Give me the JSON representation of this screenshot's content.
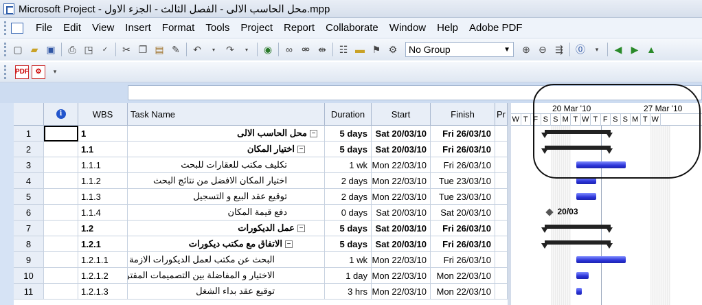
{
  "window": {
    "title": "Microsoft Project - محل الحاسب الالى - الفصل الثالث - الجزء الاول.mpp"
  },
  "menu": [
    {
      "label": "File"
    },
    {
      "label": "Edit"
    },
    {
      "label": "View"
    },
    {
      "label": "Insert"
    },
    {
      "label": "Format"
    },
    {
      "label": "Tools"
    },
    {
      "label": "Project"
    },
    {
      "label": "Report"
    },
    {
      "label": "Collaborate"
    },
    {
      "label": "Window"
    },
    {
      "label": "Help"
    },
    {
      "label": "Adobe PDF"
    }
  ],
  "toolbar": {
    "group_value": "No Group"
  },
  "columns": {
    "info": "i",
    "wbs": "WBS",
    "task_name": "Task Name",
    "duration": "Duration",
    "start": "Start",
    "finish": "Finish",
    "pred": "Pr"
  },
  "timescale": {
    "weeks": [
      "20 Mar '10",
      "27 Mar '10"
    ],
    "days": [
      "W",
      "T",
      "F",
      "S",
      "S",
      "M",
      "T",
      "W",
      "T",
      "F",
      "S",
      "S",
      "M",
      "T",
      "W"
    ]
  },
  "tasks": [
    {
      "id": "1",
      "wbs": "1",
      "name": "محل الحاسب الالى",
      "duration": "5 days",
      "start": "Sat 20/03/10",
      "finish": "Fri 26/03/10",
      "summary": true
    },
    {
      "id": "2",
      "wbs": "1.1",
      "name": "اختيار المكان",
      "duration": "5 days",
      "start": "Sat 20/03/10",
      "finish": "Fri 26/03/10",
      "summary": true
    },
    {
      "id": "3",
      "wbs": "1.1.1",
      "name": "تكليف مكتب للعقارات للبحث",
      "duration": "1 wk",
      "start": "Mon 22/03/10",
      "finish": "Fri 26/03/10",
      "summary": false
    },
    {
      "id": "4",
      "wbs": "1.1.2",
      "name": "اختيار المكان الافضل من نتائج البحث",
      "duration": "2 days",
      "start": "Mon 22/03/10",
      "finish": "Tue 23/03/10",
      "summary": false
    },
    {
      "id": "5",
      "wbs": "1.1.3",
      "name": "توقيع عقد البيع و التسجيل",
      "duration": "2 days",
      "start": "Mon 22/03/10",
      "finish": "Tue 23/03/10",
      "summary": false
    },
    {
      "id": "6",
      "wbs": "1.1.4",
      "name": "دفع قيمة المكان",
      "duration": "0 days",
      "start": "Sat 20/03/10",
      "finish": "Sat 20/03/10",
      "summary": false,
      "milestone_label": "20/03"
    },
    {
      "id": "7",
      "wbs": "1.2",
      "name": "عمل الديكورات",
      "duration": "5 days",
      "start": "Sat 20/03/10",
      "finish": "Fri 26/03/10",
      "summary": true
    },
    {
      "id": "8",
      "wbs": "1.2.1",
      "name": "الاتفاق مع مكتب ديكورات",
      "duration": "5 days",
      "start": "Sat 20/03/10",
      "finish": "Fri 26/03/10",
      "summary": true
    },
    {
      "id": "9",
      "wbs": "1.2.1.1",
      "name": "البحث عن مكتب لعمل الديكورات الازمة",
      "duration": "1 wk",
      "start": "Mon 22/03/10",
      "finish": "Fri 26/03/10",
      "summary": false
    },
    {
      "id": "10",
      "wbs": "1.2.1.2",
      "name": "الاختيار و المفاضلة بين التصميمات المقترحة",
      "duration": "1 day",
      "start": "Mon 22/03/10",
      "finish": "Mon 22/03/10",
      "summary": false
    },
    {
      "id": "11",
      "wbs": "1.2.1.3",
      "name": "توقيع عقد بداء الشغل",
      "duration": "3 hrs",
      "start": "Mon 22/03/10",
      "finish": "Mon 22/03/10",
      "summary": false
    }
  ]
}
